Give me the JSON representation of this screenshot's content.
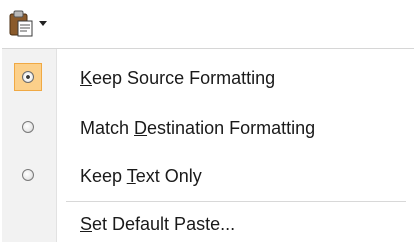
{
  "paste_button": {
    "icon": "clipboard-paste-icon",
    "arrow": "chevron-down-icon"
  },
  "menu": {
    "items": [
      {
        "type": "radio",
        "selected": true,
        "label_prefix": "",
        "label_mnemonic": "K",
        "label_suffix": "eep Source Formatting"
      },
      {
        "type": "radio",
        "selected": false,
        "label_prefix": "Match ",
        "label_mnemonic": "D",
        "label_suffix": "estination Formatting"
      },
      {
        "type": "radio",
        "selected": false,
        "label_prefix": "Keep ",
        "label_mnemonic": "T",
        "label_suffix": "ext Only"
      },
      {
        "type": "action",
        "label_prefix": "",
        "label_mnemonic": "S",
        "label_suffix": "et Default Paste..."
      }
    ]
  },
  "colors": {
    "selected_fill": "#fcd08a",
    "selected_border": "#f0a944",
    "gutter": "#f2f2f2"
  }
}
